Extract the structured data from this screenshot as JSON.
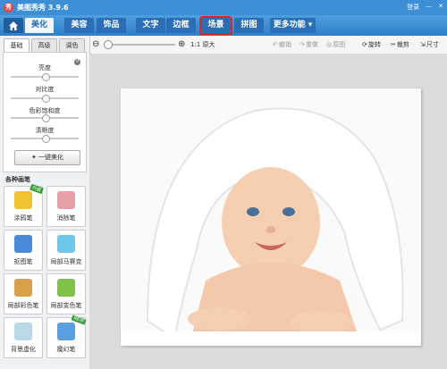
{
  "app": {
    "title": "美图秀秀 3.9.6",
    "logo": "秀",
    "login": "登录",
    "minimize": "—",
    "close": "✕"
  },
  "nav": {
    "tabs": [
      "美化",
      "美容",
      "饰品",
      "文字",
      "边框",
      "场景",
      "拼图",
      "更多功能 ▾"
    ],
    "active": "美化",
    "highlighted": "场景"
  },
  "toolbar": {
    "zoom_out": "⊖",
    "zoom_in": "⊕",
    "original": "1:1 原大",
    "undo": "撤销",
    "redo": "重做",
    "restore": "原图",
    "rotate": "旋转",
    "crop": "裁剪",
    "resize": "尺寸"
  },
  "left": {
    "subtabs": [
      "基础",
      "高级",
      "调色"
    ],
    "sliders": [
      "亮度",
      "对比度",
      "色彩饱和度",
      "清晰度"
    ],
    "one_click": "一键美化",
    "brush_title": "各种画笔",
    "brushes": [
      {
        "label": "涂鸦笔",
        "badge": "升级"
      },
      {
        "label": "消除笔",
        "badge": ""
      },
      {
        "label": "抠图笔",
        "badge": ""
      },
      {
        "label": "局部马赛克",
        "badge": ""
      },
      {
        "label": "局部彩色笔",
        "badge": ""
      },
      {
        "label": "局部变色笔",
        "badge": ""
      },
      {
        "label": "背景虚化",
        "badge": ""
      },
      {
        "label": "魔幻笔",
        "badge": "NEW"
      }
    ]
  },
  "colors": {
    "nav": "#2f7fc8",
    "highlight": "#e42424",
    "canvas": "#dcdcdc"
  }
}
